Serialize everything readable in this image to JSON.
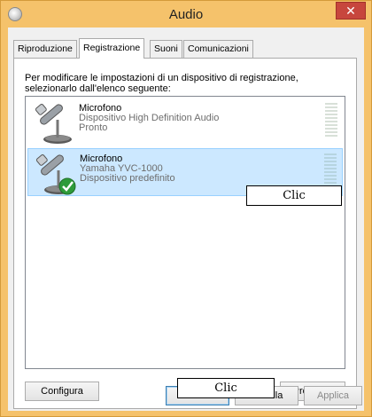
{
  "window": {
    "title": "Audio",
    "close_glyph": "✕"
  },
  "tabs": [
    {
      "label": "Riproduzione",
      "active": false
    },
    {
      "label": "Registrazione",
      "active": true
    },
    {
      "label": "Suoni",
      "active": false
    },
    {
      "label": "Comunicazioni",
      "active": false
    }
  ],
  "instructions": "Per modificare le impostazioni di un dispositivo di registrazione, selezionarlo dall'elenco seguente:",
  "devices": [
    {
      "name": "Microfono",
      "description": "Dispositivo High Definition Audio",
      "status": "Pronto",
      "selected": false,
      "icon": "microphone-icon"
    },
    {
      "name": "Microfono",
      "description": "Yamaha YVC-1000",
      "status": "Dispositivo predefinito",
      "selected": true,
      "icon": "microphone-icon",
      "badge": "default-check-icon"
    }
  ],
  "callouts": {
    "list": "Clic",
    "properties": "Clic"
  },
  "panel_buttons": {
    "configure": "Configura",
    "properties": "Proprietà"
  },
  "dialog_buttons": {
    "ok": "OK",
    "cancel": "Annulla",
    "apply": "Applica"
  },
  "colors": {
    "titlebar": "#f5c26b",
    "selection": "#cce8ff",
    "close": "#c7463d"
  }
}
